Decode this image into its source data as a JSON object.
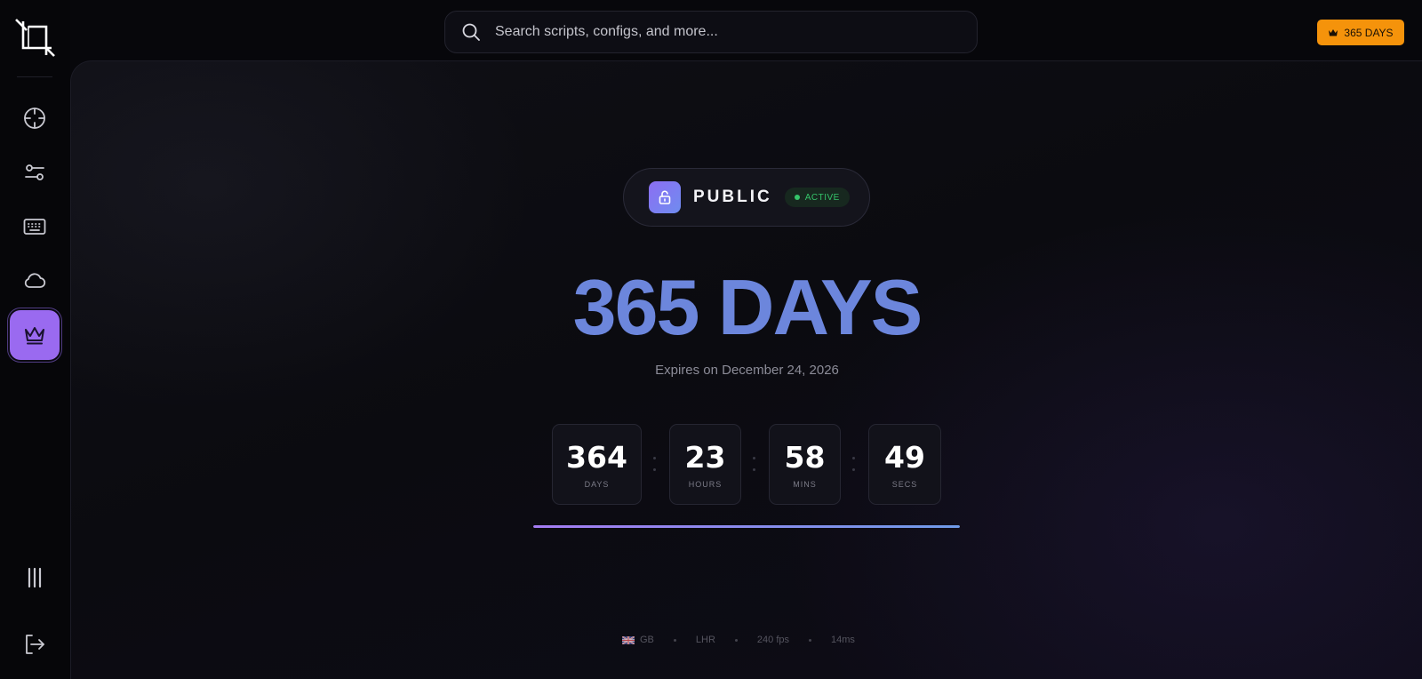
{
  "search": {
    "placeholder": "Search scripts, configs, and more...",
    "icon": "search-icon"
  },
  "header": {
    "plan_badge_label": "365 DAYS",
    "plan_badge_icon": "crown-icon",
    "plan_badge_color": "#f5930b"
  },
  "sidebar": {
    "logo_icon": "crop-logo-icon",
    "items": [
      {
        "name": "crosshair",
        "icon": "crosshair-icon",
        "active": false
      },
      {
        "name": "settings",
        "icon": "sliders-icon",
        "active": false
      },
      {
        "name": "keybinds",
        "icon": "keyboard-icon",
        "active": false
      },
      {
        "name": "cloud",
        "icon": "cloud-icon",
        "active": false
      },
      {
        "name": "premium",
        "icon": "crown-icon",
        "active": true
      }
    ],
    "bottom_items": [
      {
        "name": "library",
        "icon": "library-icon"
      },
      {
        "name": "logout",
        "icon": "logout-icon"
      }
    ],
    "accent_color": "#9a6af0"
  },
  "subscription": {
    "tier_label": "PUBLIC",
    "tier_icon": "lock-open-icon",
    "status_label": "ACTIVE",
    "status_color": "#35c46a",
    "duration_title": "365 DAYS",
    "title_color": "#6c86dc",
    "expires_text": "Expires on December 24, 2026",
    "countdown": [
      {
        "value": "364",
        "label": "DAYS"
      },
      {
        "value": "23",
        "label": "HOURS"
      },
      {
        "value": "58",
        "label": "MINS"
      },
      {
        "value": "49",
        "label": "SECS"
      }
    ],
    "progress_fraction": 1.0
  },
  "footer": {
    "region": "GB",
    "region_icon": "uk-flag-icon",
    "server": "LHR",
    "fps": "240 fps",
    "latency": "14ms"
  }
}
